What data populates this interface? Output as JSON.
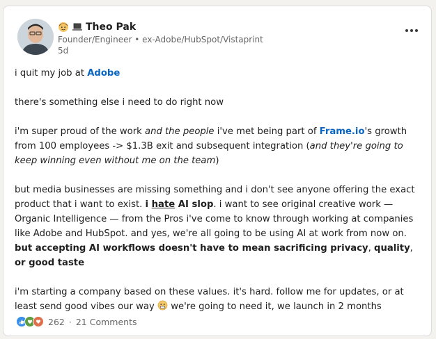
{
  "author": {
    "name": "Theo Pak",
    "subtitle": "Founder/Engineer • ex-Adobe/HubSpot/Vistaprint",
    "time": "5d",
    "name_emojis": [
      "person-emoji",
      "laptop-emoji"
    ]
  },
  "post": {
    "p1_pre": "i quit my job at ",
    "p1_link": "Adobe",
    "p2": "there's something else i need to do right now",
    "p3_a": "i'm super proud of the work ",
    "p3_b": "and the people",
    "p3_c": " i've met being part of ",
    "p3_link": "Frame.io",
    "p3_d": "'s growth from 100 employees -> $1.3B exit and subsequent integration (",
    "p3_e": "and they're going to keep winning even without me on the team",
    "p3_f": ")",
    "p4_a": "but media businesses are missing something and i don't see anyone offering the exact product that i want to exist. ",
    "p4_b1": "i ",
    "p4_b2": "hate",
    "p4_b3": " AI slop",
    "p4_c": ". i want to see original creative work — Organic Intelligence — from the Pros i've come to know through working at companies like Adobe and HubSpot. and yes, we're all going to be using AI at work from now on. ",
    "p4_d": "but accepting AI workflows doesn't have to mean sacrificing privacy",
    "p4_e": ", ",
    "p4_f": "quality",
    "p4_g": ", ",
    "p4_h": "or good taste",
    "p5_a": "i'm starting a company based on these values. it's hard. follow me for updates, or at least send good vibes our way ",
    "p5_b": " we're going to need it, we launch in 2 months"
  },
  "social": {
    "reactions": [
      "like-icon",
      "support-icon",
      "love-icon"
    ],
    "count": "262",
    "separator": "·",
    "comments": "21 Comments"
  },
  "colors": {
    "link": "#0a66c2",
    "like": "#378fe9",
    "support": "#5f9b41",
    "love": "#df704d"
  }
}
